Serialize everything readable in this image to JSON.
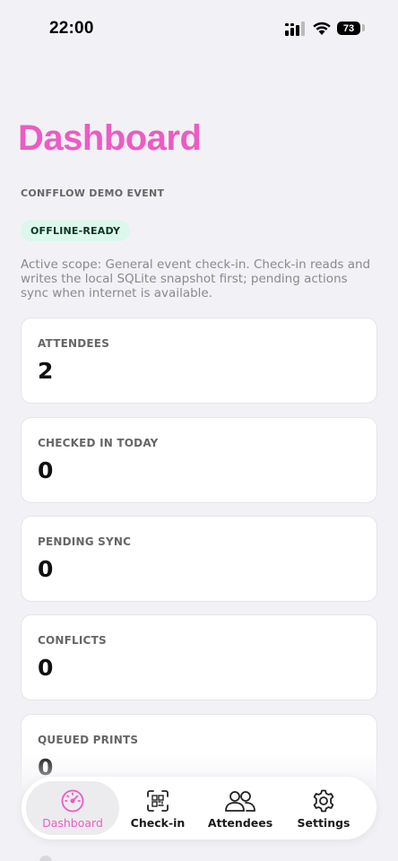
{
  "status_bar": {
    "time": "22:00",
    "battery": "73"
  },
  "header": {
    "title": "Dashboard",
    "event_name": "CONFFLOW DEMO EVENT",
    "badge": "OFFLINE-READY",
    "scope_text": "Active scope: General event check-in. Check-in reads and writes the local SQLite snapshot first; pending actions sync when internet is available."
  },
  "stats": [
    {
      "label": "ATTENDEES",
      "value": "2"
    },
    {
      "label": "CHECKED IN TODAY",
      "value": "0"
    },
    {
      "label": "PENDING SYNC",
      "value": "0"
    },
    {
      "label": "CONFLICTS",
      "value": "0"
    },
    {
      "label": "QUEUED PRINTS",
      "value": "0"
    }
  ],
  "tabs": [
    {
      "label": "Dashboard",
      "icon": "gauge-icon",
      "active": true
    },
    {
      "label": "Check-in",
      "icon": "qr-scan-icon",
      "active": false
    },
    {
      "label": "Attendees",
      "icon": "people-icon",
      "active": false
    },
    {
      "label": "Settings",
      "icon": "gear-icon",
      "active": false
    }
  ],
  "colors": {
    "accent": "#ec5cc4",
    "badge_bg": "#dcf7ec",
    "background": "#f2f2f6"
  }
}
